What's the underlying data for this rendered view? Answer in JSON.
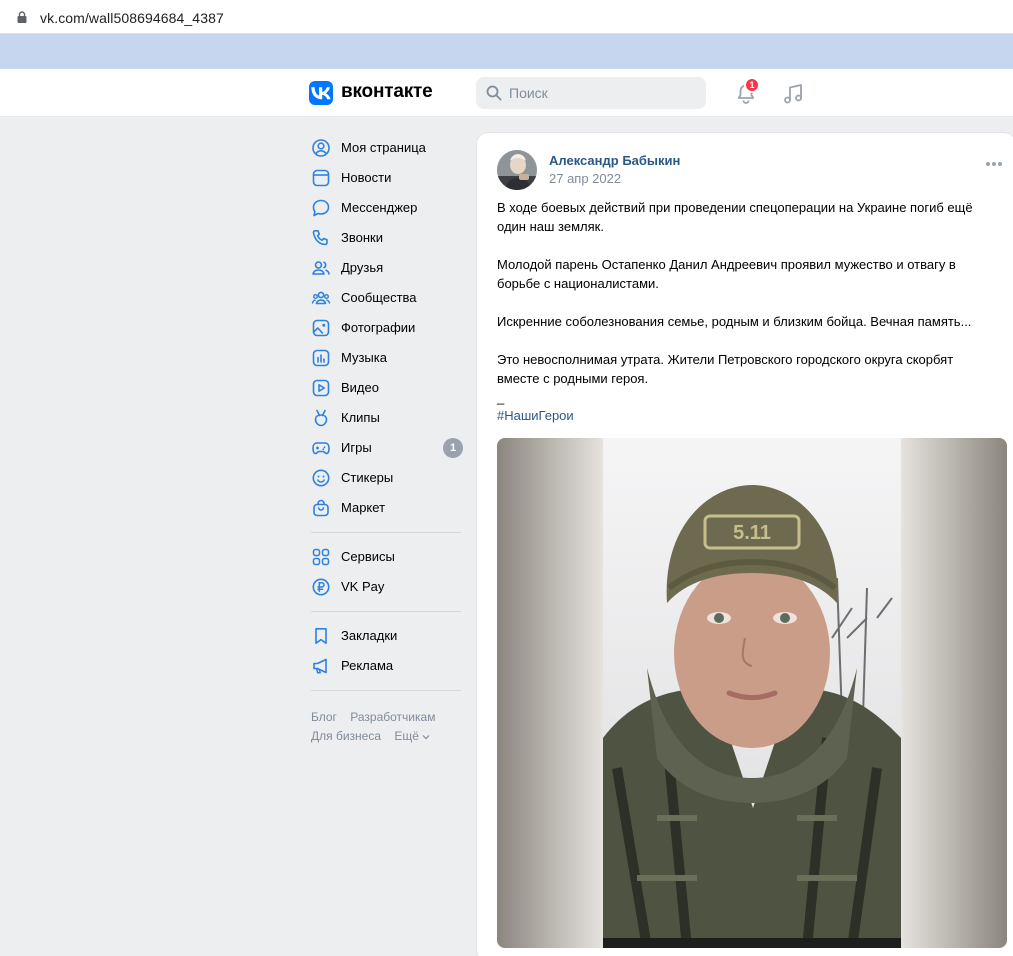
{
  "browser": {
    "url": "vk.com/wall508694684_4387",
    "icons": {
      "lock": "lock-icon"
    }
  },
  "header": {
    "logo_text": "вконтакте",
    "search_placeholder": "Поиск",
    "notifications_count": "1",
    "icons": [
      "vk-logo-icon",
      "search-icon",
      "bell-icon",
      "music-icon"
    ]
  },
  "sidebar": {
    "items": [
      {
        "label": "Моя страница",
        "icon": "user-circle-icon"
      },
      {
        "label": "Новости",
        "icon": "newsfeed-icon"
      },
      {
        "label": "Мессенджер",
        "icon": "message-icon"
      },
      {
        "label": "Звонки",
        "icon": "phone-icon"
      },
      {
        "label": "Друзья",
        "icon": "friends-icon"
      },
      {
        "label": "Сообщества",
        "icon": "communities-icon"
      },
      {
        "label": "Фотографии",
        "icon": "photos-icon"
      },
      {
        "label": "Музыка",
        "icon": "music-icon"
      },
      {
        "label": "Видео",
        "icon": "video-icon"
      },
      {
        "label": "Клипы",
        "icon": "clips-icon"
      },
      {
        "label": "Игры",
        "icon": "gamepad-icon",
        "count": "1"
      },
      {
        "label": "Стикеры",
        "icon": "smile-icon"
      },
      {
        "label": "Маркет",
        "icon": "market-bag-icon"
      }
    ],
    "items2": [
      {
        "label": "Сервисы",
        "icon": "services-grid-icon"
      },
      {
        "label": "VK Pay",
        "icon": "ruble-icon"
      }
    ],
    "items3": [
      {
        "label": "Закладки",
        "icon": "bookmark-icon"
      },
      {
        "label": "Реклама",
        "icon": "megaphone-icon"
      }
    ],
    "footer": {
      "blog": "Блог",
      "developers": "Разработчикам",
      "business": "Для бизнеса",
      "more": "Ещё"
    }
  },
  "post": {
    "author": "Александр Бабыкин",
    "date": "27 апр 2022",
    "paragraphs": [
      "В ходе боевых действий при проведении спецоперации на Украине погиб ещё один наш земляк.",
      "Молодой парень Остапенко Данил Андреевич проявил мужество и отвагу в борьбе с националистами.",
      "Искренние соболезнования семье, родным и близким бойца. Вечная память...",
      "Это невосполнимая утрата. Жители Петровского городского округа скорбят вместе с родными героя."
    ],
    "dash": "_",
    "hashtag": "#НашиГерои",
    "photo_alt": "portrait-photo"
  },
  "colors": {
    "vk_blue": "#0077ff",
    "link": "#2a5885",
    "badge_red": "#ff3347",
    "page_bg": "#edeef0",
    "bookmarks_bar": "#c7d6ef"
  }
}
